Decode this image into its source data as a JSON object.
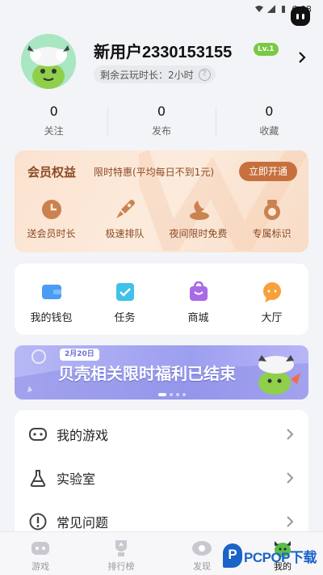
{
  "status_bar": {
    "time": "6:08"
  },
  "profile": {
    "username": "新用户2330153155",
    "level": "Lv.1",
    "playtime": "剩余云玩时长：2小时"
  },
  "stats": [
    {
      "value": "0",
      "label": "关注"
    },
    {
      "value": "0",
      "label": "发布"
    },
    {
      "value": "0",
      "label": "收藏"
    }
  ],
  "vip": {
    "title": "会员权益",
    "subtitle": "限时特惠(平均每日不到1元)",
    "cta": "立即开通",
    "items": [
      {
        "label": "送会员时长",
        "icon": "clock-icon"
      },
      {
        "label": "极速排队",
        "icon": "rocket-icon"
      },
      {
        "label": "夜间限时免费",
        "icon": "moon-cloud-icon"
      },
      {
        "label": "专属标识",
        "icon": "medal-icon"
      }
    ]
  },
  "quick_links": [
    {
      "label": "我的钱包",
      "icon": "wallet-icon"
    },
    {
      "label": "任务",
      "icon": "task-check-icon"
    },
    {
      "label": "商城",
      "icon": "shop-bag-icon"
    },
    {
      "label": "大厅",
      "icon": "chat-bubble-icon"
    }
  ],
  "banner": {
    "date": "2月20日",
    "text": "贝壳相关限时福利已结束"
  },
  "menu": [
    {
      "label": "我的游戏",
      "icon": "gamepad-icon"
    },
    {
      "label": "实验室",
      "icon": "flask-icon"
    },
    {
      "label": "常见问题",
      "icon": "question-icon"
    }
  ],
  "tabs": [
    {
      "label": "游戏",
      "icon": "gamepad-tab-icon",
      "active": false
    },
    {
      "label": "排行榜",
      "icon": "trophy-tab-icon",
      "active": false
    },
    {
      "label": "发现",
      "icon": "eye-tab-icon",
      "active": false
    },
    {
      "label": "我的",
      "icon": "mascot-tab-icon",
      "active": true
    }
  ],
  "watermark": {
    "logo": "P",
    "text": "PCPOP下载"
  },
  "colors": {
    "vip_text": "#8b4a24",
    "vip_button": "#c7703e",
    "banner": "#9c9ef0",
    "level_badge": "#7ac943"
  }
}
